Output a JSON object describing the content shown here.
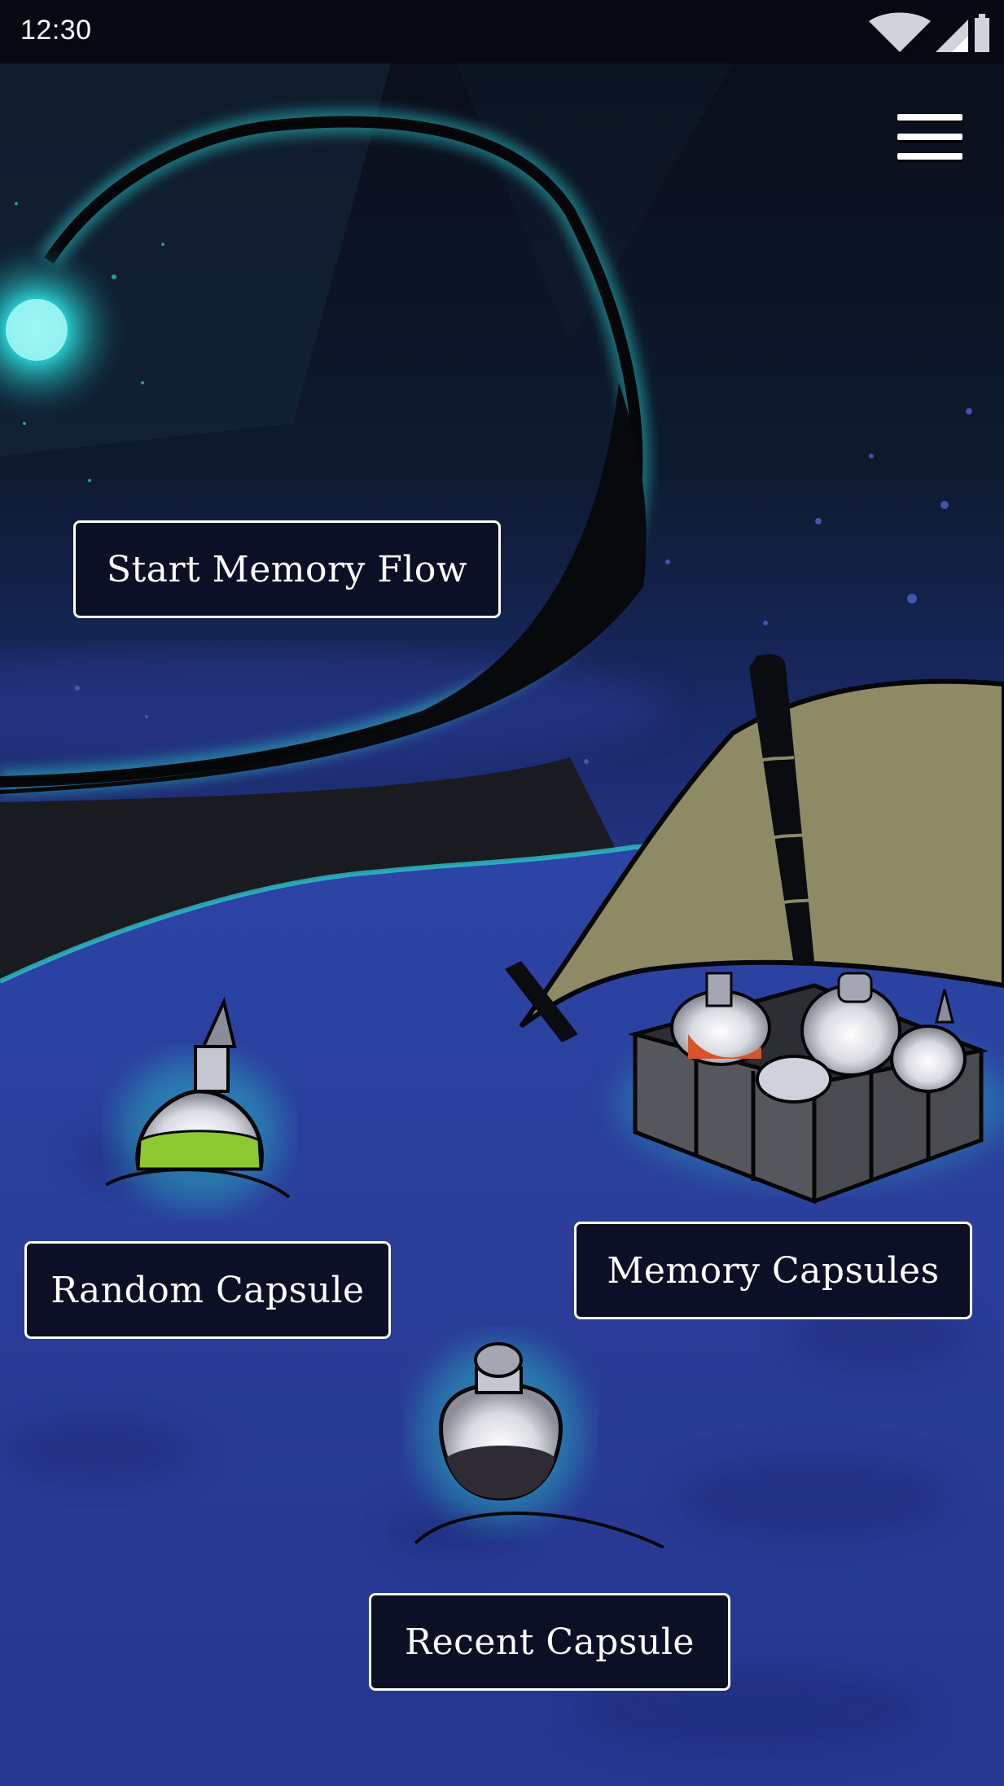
{
  "status_bar": {
    "time": "12:30",
    "icons": [
      "wifi-icon",
      "cellular-signal-icon",
      "battery-icon"
    ]
  },
  "header": {
    "menu_icon": "hamburger-menu-icon"
  },
  "actions": {
    "start_memory_flow": "Start Memory Flow",
    "random_capsule": "Random Capsule",
    "memory_capsules": "Memory Capsules",
    "recent_capsule": "Recent Capsule"
  },
  "colors": {
    "sky_dark": "#0a0f22",
    "sea_blue": "#2a3f9a",
    "glow_teal": "#29d3d8",
    "button_bg": "#0b1026",
    "button_border": "#ffffff",
    "sail_khaki": "#8e8a66",
    "potion_green": "#8ec832",
    "potion_orange": "#d9532a"
  }
}
